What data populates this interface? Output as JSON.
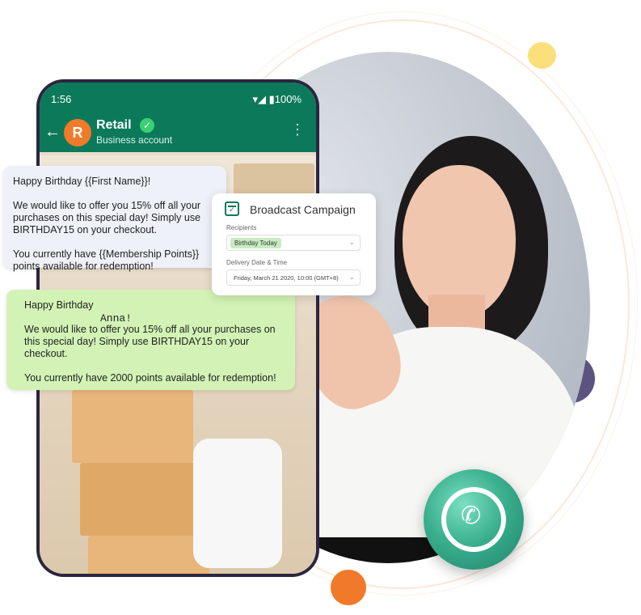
{
  "phone": {
    "status_time": "1:56",
    "status_battery": "▾◢ ▮100%",
    "contact_initial": "R",
    "contact_name": "Retail",
    "contact_subtitle": "Business account"
  },
  "template_message": {
    "text": "Happy Birthday {{First Name}}!\n\nWe would like to offer you 15% off all your purchases on this special day! Simply use BIRTHDAY15 on your checkout.\n\nYou currently have {{Membership Points}} points available for redemption!"
  },
  "sent_message": {
    "text": "Happy Birthday\n\nWe would like to offer you 15% off all your purchases on this special day! Simply use BIRTHDAY15 on your checkout.\n\nYou currently have 2000 points available for redemption!",
    "name_overlay": "Anna!"
  },
  "campaign_card": {
    "title": "Broadcast Campaign",
    "recipients_label": "Recipients",
    "recipients_value": "Birthday Today",
    "delivery_label": "Delivery Date & Time",
    "delivery_value": "Friday, March 21 2020, 10:00 (GMT+8)"
  },
  "icons": [
    "back-arrow-icon",
    "verified-icon",
    "more-vert-icon",
    "calendar-icon",
    "chevron-down-icon",
    "whatsapp-icon"
  ],
  "colors": {
    "whatsapp_green": "#0c7a5a",
    "accent_orange": "#f07a2a",
    "accent_yellow": "#fbdf7a",
    "accent_purple": "#5c5381",
    "bubble_green": "#d2f3b5",
    "bubble_gray": "#eef1f8"
  }
}
